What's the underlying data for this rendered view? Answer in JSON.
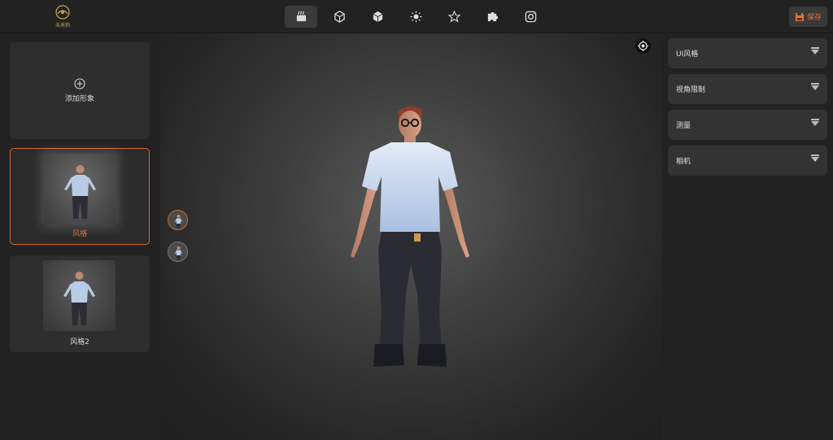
{
  "topbar": {
    "logo_text": "未来狗",
    "tools": [
      {
        "icon": "scene-icon",
        "active": true
      },
      {
        "icon": "model-box-icon",
        "active": false
      },
      {
        "icon": "cube-icon",
        "active": false
      },
      {
        "icon": "light-icon",
        "active": false
      },
      {
        "icon": "star-icon",
        "active": false
      },
      {
        "icon": "puzzle-icon",
        "active": false
      },
      {
        "icon": "camera-icon",
        "active": false
      }
    ],
    "save_label": "保存",
    "accent_color": "#e8742c"
  },
  "left": {
    "add_label": "添加形象",
    "styles": [
      {
        "label": "风格",
        "selected": true
      },
      {
        "label": "风格2",
        "selected": false
      }
    ]
  },
  "viewport": {
    "icons": [
      "target-icon"
    ]
  },
  "right": {
    "sections": [
      {
        "label": "UI风格"
      },
      {
        "label": "视角限制"
      },
      {
        "label": "测量"
      },
      {
        "label": "相机"
      }
    ]
  }
}
